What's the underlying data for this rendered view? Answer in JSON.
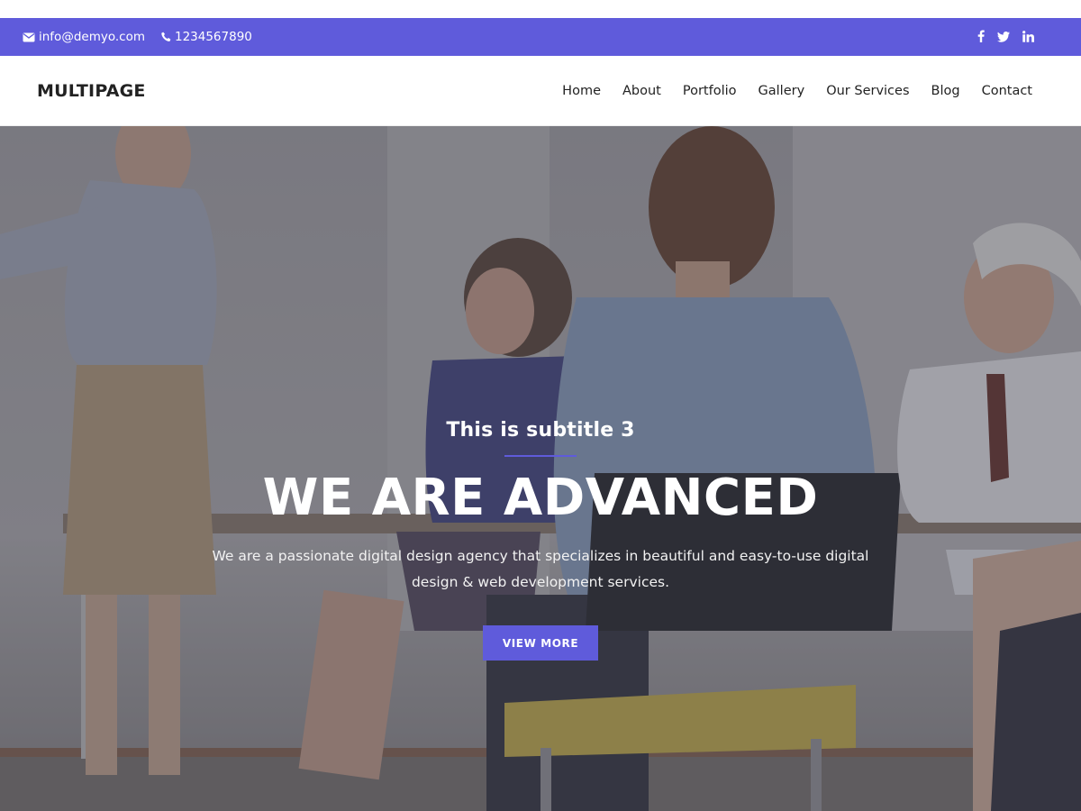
{
  "topbar": {
    "email": "info@demyo.com",
    "phone": "1234567890",
    "icons": [
      "envelope-icon",
      "phone-icon",
      "facebook-icon",
      "twitter-icon",
      "linkedin-icon"
    ],
    "color": "#5f5bdb"
  },
  "header": {
    "brand": "MULTIPAGE",
    "nav": [
      "Home",
      "About",
      "Portfolio",
      "Gallery",
      "Our Services",
      "Blog",
      "Contact"
    ]
  },
  "hero": {
    "subtitle": "This is subtitle 3",
    "title": "WE ARE ADVANCED",
    "description": "We are a passionate digital design agency that specializes in beautiful and easy-to-use digital design & web development services.",
    "button_label": "VIEW MORE",
    "accent": "#5f5bdb"
  }
}
